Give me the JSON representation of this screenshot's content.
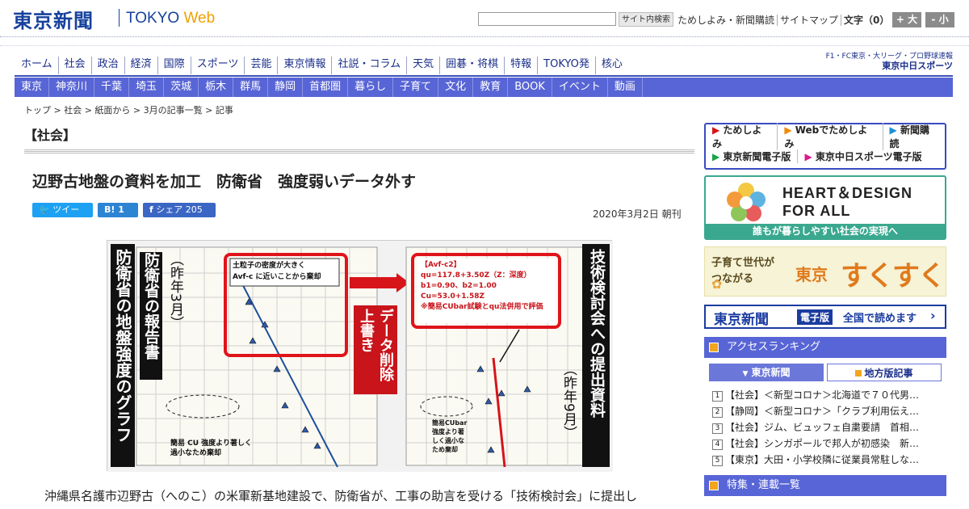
{
  "header": {
    "logo_text": "東京新聞",
    "logo_sub": "TOKYO",
    "logo_web": "Web",
    "search_button": "サイト内検索",
    "links": [
      "ためしよみ・新聞購読",
      "サイトマップ",
      "文字（0）"
    ],
    "font_plus": "+ 大",
    "font_minus": "- 小"
  },
  "nav_main": [
    "ホーム",
    "社会",
    "政治",
    "経済",
    "国際",
    "スポーツ",
    "芸能",
    "東京情報",
    "社説・コラム",
    "天気",
    "囲碁・将棋",
    "特報",
    "TOKYO発",
    "核心"
  ],
  "sports_banner": {
    "line1": "F1・FC東京・大リーグ・プロ野球速報",
    "line2": "東京中日スポーツ"
  },
  "nav_sub": [
    "東京",
    "神奈川",
    "千葉",
    "埼玉",
    "茨城",
    "栃木",
    "群馬",
    "静岡",
    "首都圏",
    "暮らし",
    "子育て",
    "文化",
    "教育",
    "BOOK",
    "イベント",
    "動画"
  ],
  "breadcrumb": "トップ > 社会 > 紙面から > 3月の記事一覧 > 記事",
  "section_title": "【社会】",
  "article": {
    "headline": "辺野古地盤の資料を加工　防衛省　強度弱いデータ外す",
    "date": "2020年3月2日 朝刊",
    "body": "　沖縄県名護市辺野古（へのこ）の米軍新基地建設で、防衛省が、工事の助言を受ける「技術検討会」に提出し"
  },
  "share": {
    "tweet": "ツイート",
    "hatena": "B! 1",
    "facebook": "シェア 205"
  },
  "figure": {
    "left_title": "防衛省の地盤強度のグラフ",
    "left_sub": "防衛省の報告書",
    "left_when": "（昨年3月）",
    "left_callout": "土粒子の密度が大きく\nAvf-c に近いことから棄却",
    "left_note": "簡易 CU 強度より著しく\n過小なため棄却",
    "arrow_label": "データ削除\n上書き",
    "right_title": "技術検討会への提出資料",
    "right_when": "（昨年9月）",
    "right_callout": "【Avf-c2】\nqu=117.8+3.50Z（Z：深度）\nb1=0.90、b2=1.00\nCu=53.0+1.58Z\n※簡易CUbar試験とqu法併用で評価",
    "right_note": "簡易CUbar\n強度より著\nしく過小な\nため棄却"
  },
  "sidebar": {
    "quick_links": [
      "ためしよみ",
      "Webでためしよみ",
      "新聞購読",
      "東京新聞電子版",
      "東京中日スポーツ電子版"
    ],
    "heart_title": "HEART＆DESIGN\nFOR ALL",
    "heart_sub": "誰もが暮らしやすい社会の実現へ",
    "suku_small": "子育て世代が\nつながる",
    "suku_big1": "東京",
    "suku_big2": "すくすく",
    "edenshi_logo": "東京新聞",
    "edenshi_tag": "電子版",
    "edenshi_text": "全国で読めます",
    "ranking_title": "アクセスランキング",
    "tab_active": "東京新聞",
    "tab_other": "地方版記事",
    "ranking": [
      {
        "num": "1",
        "text": "【社会】＜新型コロナ＞北海道で７０代男…"
      },
      {
        "num": "2",
        "text": "【静岡】＜新型コロナ＞「クラブ利用伝え…"
      },
      {
        "num": "3",
        "text": "【社会】ジム、ビュッフェ自粛要請　首相…"
      },
      {
        "num": "4",
        "text": "【社会】シンガポールで邦人が初感染　新…"
      },
      {
        "num": "5",
        "text": "【東京】大田・小学校隣に従業員常駐しな…"
      }
    ],
    "tokushu_title": "特集・連載一覧"
  }
}
